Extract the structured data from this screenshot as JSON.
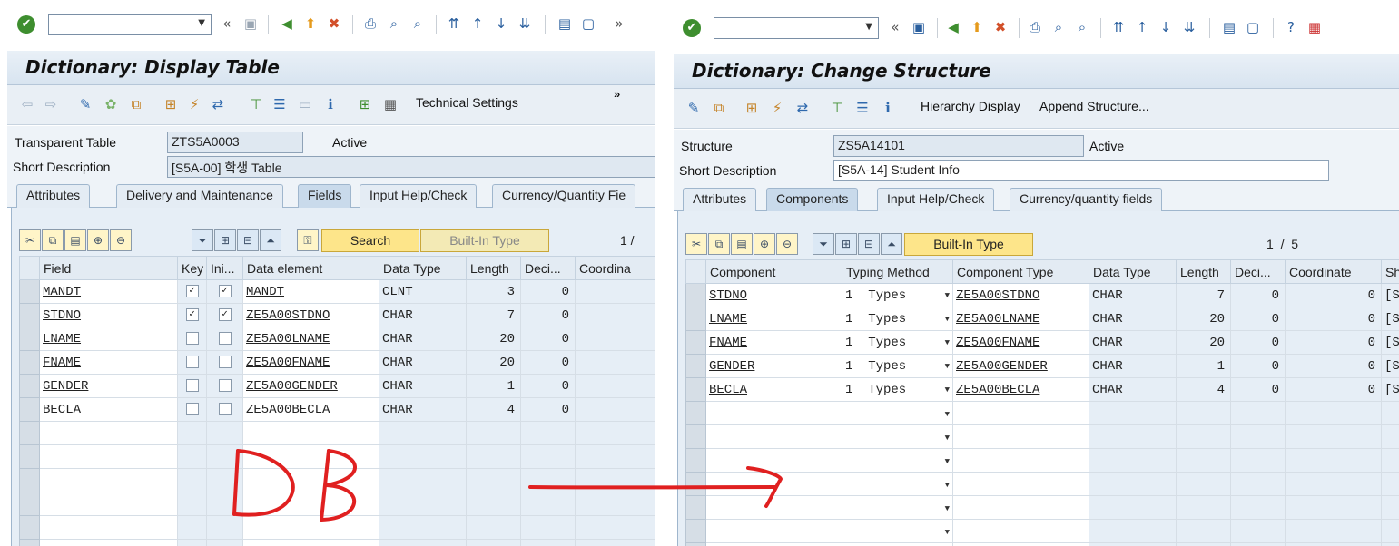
{
  "left": {
    "title": "Dictionary: Display Table",
    "toolbar": {
      "technical_settings": "Technical Settings",
      "more": "»"
    },
    "header": {
      "type_label": "Transparent Table",
      "type_value": "ZTS5A0003",
      "status": "Active",
      "desc_label": "Short Description",
      "desc_value": "[S5A-00] 학생 Table"
    },
    "tabs": [
      "Attributes",
      "Delivery and Maintenance",
      "Fields",
      "Input Help/Check",
      "Currency/Quantity Fie"
    ],
    "active_tab": "Fields",
    "grid_toolbar": {
      "search": "Search",
      "builtin": "Built-In Type",
      "counter": "1 /"
    },
    "columns": [
      "Field",
      "Key",
      "Ini...",
      "Data element",
      "Data Type",
      "Length",
      "Deci...",
      "Coordina"
    ],
    "rows": [
      {
        "field": "MANDT",
        "key": true,
        "init": true,
        "element": "MANDT",
        "type": "CLNT",
        "length": "3",
        "dec": "0"
      },
      {
        "field": "STDNO",
        "key": true,
        "init": true,
        "element": "ZE5A00STDNO",
        "type": "CHAR",
        "length": "7",
        "dec": "0"
      },
      {
        "field": "LNAME",
        "key": false,
        "init": false,
        "element": "ZE5A00LNAME",
        "type": "CHAR",
        "length": "20",
        "dec": "0"
      },
      {
        "field": "FNAME",
        "key": false,
        "init": false,
        "element": "ZE5A00FNAME",
        "type": "CHAR",
        "length": "20",
        "dec": "0"
      },
      {
        "field": "GENDER",
        "key": false,
        "init": false,
        "element": "ZE5A00GENDER",
        "type": "CHAR",
        "length": "1",
        "dec": "0"
      },
      {
        "field": "BECLA",
        "key": false,
        "init": false,
        "element": "ZE5A00BECLA",
        "type": "CHAR",
        "length": "4",
        "dec": "0"
      }
    ]
  },
  "right": {
    "title": "Dictionary: Change Structure",
    "toolbar": {
      "hierarchy": "Hierarchy Display",
      "append": "Append Structure..."
    },
    "header": {
      "type_label": "Structure",
      "type_value": "ZS5A14101",
      "status": "Active",
      "desc_label": "Short Description",
      "desc_value": "[S5A-14] Student Info"
    },
    "tabs": [
      "Attributes",
      "Components",
      "Input Help/Check",
      "Currency/quantity fields"
    ],
    "active_tab": "Components",
    "grid_toolbar": {
      "builtin": "Built-In Type",
      "counter": "1  /  5"
    },
    "columns": [
      "Component",
      "Typing Method",
      "Component Type",
      "Data Type",
      "Length",
      "Deci...",
      "Coordinate",
      "Sh"
    ],
    "rows": [
      {
        "comp": "STDNO",
        "method": "1  Types",
        "ctype": "ZE5A00STDNO",
        "type": "CHAR",
        "length": "7",
        "dec": "0",
        "coord": "0",
        "sh": "[S"
      },
      {
        "comp": "LNAME",
        "method": "1  Types",
        "ctype": "ZE5A00LNAME",
        "type": "CHAR",
        "length": "20",
        "dec": "0",
        "coord": "0",
        "sh": "[S"
      },
      {
        "comp": "FNAME",
        "method": "1  Types",
        "ctype": "ZE5A00FNAME",
        "type": "CHAR",
        "length": "20",
        "dec": "0",
        "coord": "0",
        "sh": "[S"
      },
      {
        "comp": "GENDER",
        "method": "1  Types",
        "ctype": "ZE5A00GENDER",
        "type": "CHAR",
        "length": "1",
        "dec": "0",
        "coord": "0",
        "sh": "[S"
      },
      {
        "comp": "BECLA",
        "method": "1  Types",
        "ctype": "ZE5A00BECLA",
        "type": "CHAR",
        "length": "4",
        "dec": "0",
        "coord": "0",
        "sh": "[S"
      }
    ]
  },
  "annotation": {
    "text": "DB",
    "color": "#e02020"
  },
  "colors": {
    "title_bg": "#dce7f2",
    "content_bg": "#e6eef6",
    "accent_button": "#fde58a"
  }
}
